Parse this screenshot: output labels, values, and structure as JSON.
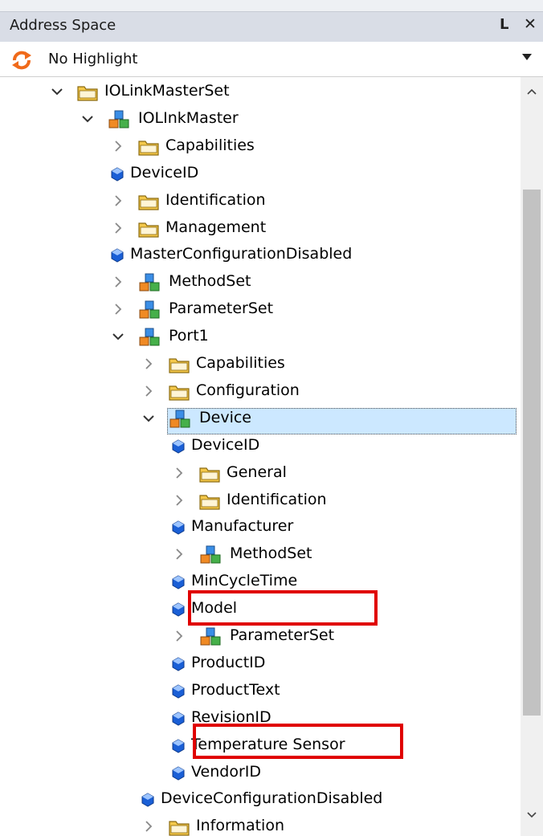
{
  "panel": {
    "title": "Address Space",
    "dock_icon": "pin-restore-icon",
    "close_icon": "close-icon"
  },
  "highlight": {
    "selected": "No Highlight"
  },
  "tree": [
    {
      "label": "IOLinkMasterSet",
      "type": "folder",
      "level": 0,
      "expander": "expanded"
    },
    {
      "label": "IOLInkMaster",
      "type": "object",
      "level": 1,
      "expander": "expanded"
    },
    {
      "label": "Capabilities",
      "type": "folder",
      "level": 2,
      "expander": "collapsed"
    },
    {
      "label": "DeviceID",
      "type": "property",
      "level": 2,
      "expander": "none"
    },
    {
      "label": "Identification",
      "type": "folder",
      "level": 2,
      "expander": "collapsed"
    },
    {
      "label": "Management",
      "type": "folder",
      "level": 2,
      "expander": "collapsed"
    },
    {
      "label": "MasterConfigurationDisabled",
      "type": "property",
      "level": 2,
      "expander": "none"
    },
    {
      "label": "MethodSet",
      "type": "object",
      "level": 2,
      "expander": "collapsed"
    },
    {
      "label": "ParameterSet",
      "type": "object",
      "level": 2,
      "expander": "collapsed"
    },
    {
      "label": "Port1",
      "type": "object",
      "level": 2,
      "expander": "expanded"
    },
    {
      "label": "Capabilities",
      "type": "folder",
      "level": 3,
      "expander": "collapsed"
    },
    {
      "label": "Configuration",
      "type": "folder",
      "level": 3,
      "expander": "collapsed"
    },
    {
      "label": "Device",
      "type": "object",
      "level": 3,
      "expander": "expanded",
      "selected": true
    },
    {
      "label": "DeviceID",
      "type": "property",
      "level": 4,
      "expander": "none"
    },
    {
      "label": "General",
      "type": "folder",
      "level": 4,
      "expander": "collapsed"
    },
    {
      "label": "Identification",
      "type": "folder",
      "level": 4,
      "expander": "collapsed"
    },
    {
      "label": "Manufacturer",
      "type": "property",
      "level": 4,
      "expander": "none"
    },
    {
      "label": "MethodSet",
      "type": "object",
      "level": 4,
      "expander": "collapsed"
    },
    {
      "label": "MinCycleTime",
      "type": "property",
      "level": 4,
      "expander": "none"
    },
    {
      "label": "Model",
      "type": "property",
      "level": 4,
      "expander": "none",
      "highlighted": true
    },
    {
      "label": "ParameterSet",
      "type": "object",
      "level": 4,
      "expander": "collapsed"
    },
    {
      "label": "ProductID",
      "type": "property",
      "level": 4,
      "expander": "none"
    },
    {
      "label": "ProductText",
      "type": "property",
      "level": 4,
      "expander": "none"
    },
    {
      "label": "RevisionID",
      "type": "property",
      "level": 4,
      "expander": "none"
    },
    {
      "label": "Temperature Sensor",
      "type": "property",
      "level": 4,
      "expander": "none",
      "highlighted": true
    },
    {
      "label": "VendorID",
      "type": "property",
      "level": 4,
      "expander": "none"
    },
    {
      "label": "DeviceConfigurationDisabled",
      "type": "property",
      "level": 3,
      "expander": "none"
    },
    {
      "label": "Information",
      "type": "folder",
      "level": 3,
      "expander": "collapsed"
    }
  ],
  "colors": {
    "selection": "#cce8ff",
    "highlight_box": "#e00000",
    "folder": "#f4c84a",
    "property": "#1a5fd6"
  }
}
